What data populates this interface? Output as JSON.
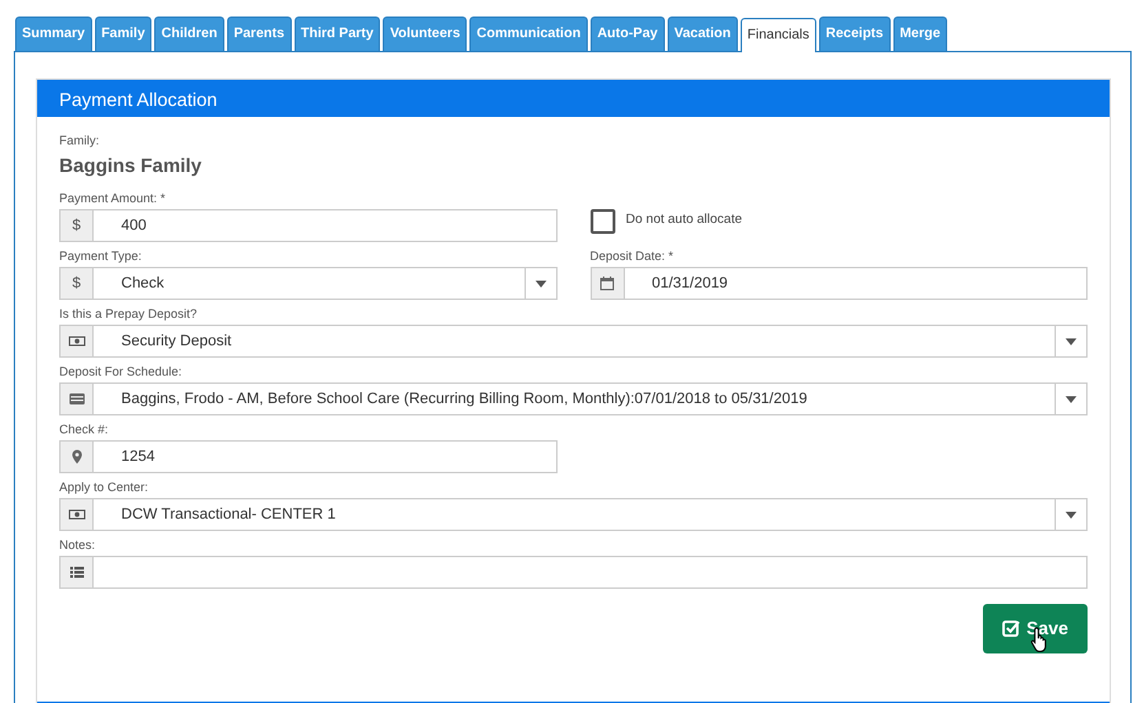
{
  "tabs": [
    {
      "label": "Summary",
      "selected": false
    },
    {
      "label": "Family",
      "selected": false
    },
    {
      "label": "Children",
      "selected": false
    },
    {
      "label": "Parents",
      "selected": false
    },
    {
      "label": "Third Party",
      "selected": false
    },
    {
      "label": "Volunteers",
      "selected": false
    },
    {
      "label": "Communication",
      "selected": false
    },
    {
      "label": "Auto-Pay",
      "selected": false
    },
    {
      "label": "Vacation",
      "selected": false
    },
    {
      "label": "Financials",
      "selected": true
    },
    {
      "label": "Receipts",
      "selected": false
    },
    {
      "label": "Merge",
      "selected": false
    }
  ],
  "panel": {
    "title": "Payment Allocation",
    "family": {
      "label": "Family:",
      "value": "Baggins Family"
    },
    "rows": [
      [
        {
          "kind": "input",
          "label": "Payment Amount: *",
          "addon": "$",
          "value": "400"
        },
        {
          "kind": "checkbox",
          "label": "Do not auto allocate",
          "checked": false
        }
      ],
      [
        {
          "kind": "select",
          "label": "Payment Type:",
          "addon": "$",
          "value": "Check"
        },
        {
          "kind": "input",
          "label": "Deposit Date: *",
          "value": "01/31/2019"
        }
      ],
      [
        {
          "kind": "select",
          "label": "Is this a Prepay Deposit?",
          "value": "Security Deposit"
        }
      ],
      [
        {
          "kind": "select",
          "label": "Deposit For Schedule:",
          "value": "Baggins, Frodo - AM, Before School Care (Recurring Billing Room, Monthly):07/01/2018 to 05/31/2019"
        }
      ],
      [
        {
          "kind": "input",
          "label": "Check #:",
          "value": "1254"
        }
      ],
      [
        {
          "kind": "select",
          "label": "Apply to Center:",
          "value": "DCW Transactional- CENTER 1"
        }
      ],
      [
        {
          "kind": "input",
          "label": "Notes:"
        }
      ]
    ],
    "save_button": "Save"
  }
}
